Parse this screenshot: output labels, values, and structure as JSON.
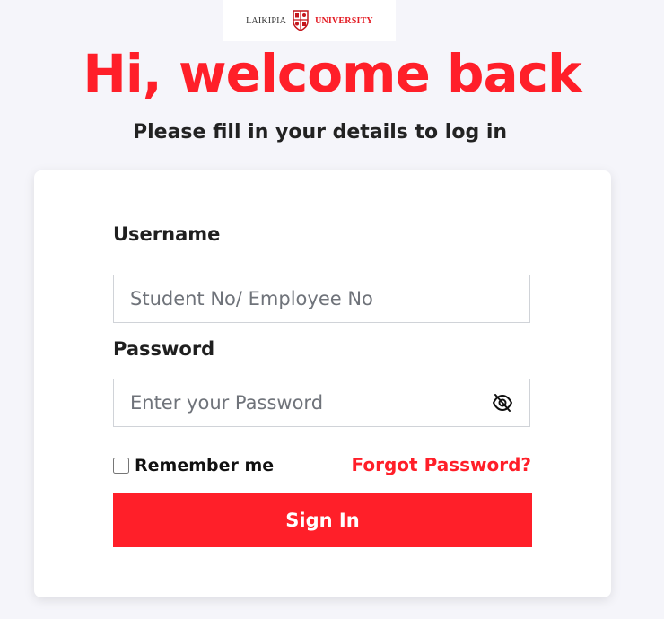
{
  "logo": {
    "left_text": "LAIKIPIA",
    "right_text": "UNIVERSITY",
    "icon": "university-crest-icon"
  },
  "header": {
    "title": "Hi, welcome back",
    "subtitle": "Please fill in your details to log in"
  },
  "form": {
    "username_label": "Username",
    "username_placeholder": "Student No/ Employee No",
    "username_value": "",
    "password_label": "Password",
    "password_placeholder": "Enter your Password",
    "password_value": "",
    "password_toggle_icon": "eye-slash-icon",
    "remember_label": "Remember me",
    "remember_checked": false,
    "forgot_label": "Forgot Password?",
    "submit_label": "Sign In"
  },
  "colors": {
    "accent": "#ff1f29",
    "background": "#f5f5fa",
    "card": "#ffffff",
    "text": "#1f1f1f"
  }
}
